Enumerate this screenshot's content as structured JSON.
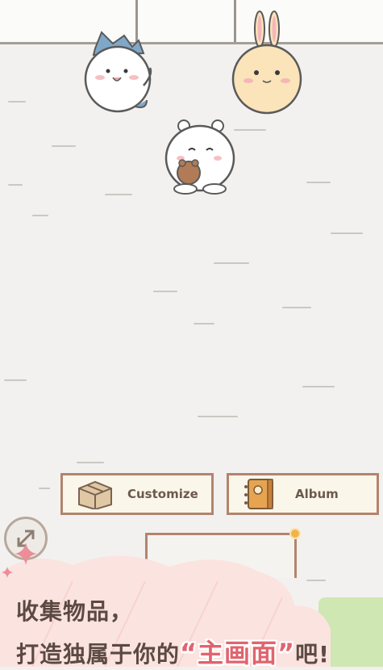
{
  "toolbar": {
    "customize_label": "Customize",
    "album_label": "Album"
  },
  "caption": {
    "line1": "收集物品，",
    "line2_prefix": "打造独属于你的",
    "highlight": "“主画面”",
    "line2_suffix": "吧!"
  },
  "colors": {
    "button_border": "#b2846d",
    "caption_text": "#5c4a42",
    "highlight": "#e0646e",
    "cloud": "#fbe3e0",
    "notification_dot": "#f0b44a"
  },
  "icons": [
    "box-icon",
    "album-book-icon",
    "resize-arrows-icon",
    "sparkle-icon"
  ]
}
